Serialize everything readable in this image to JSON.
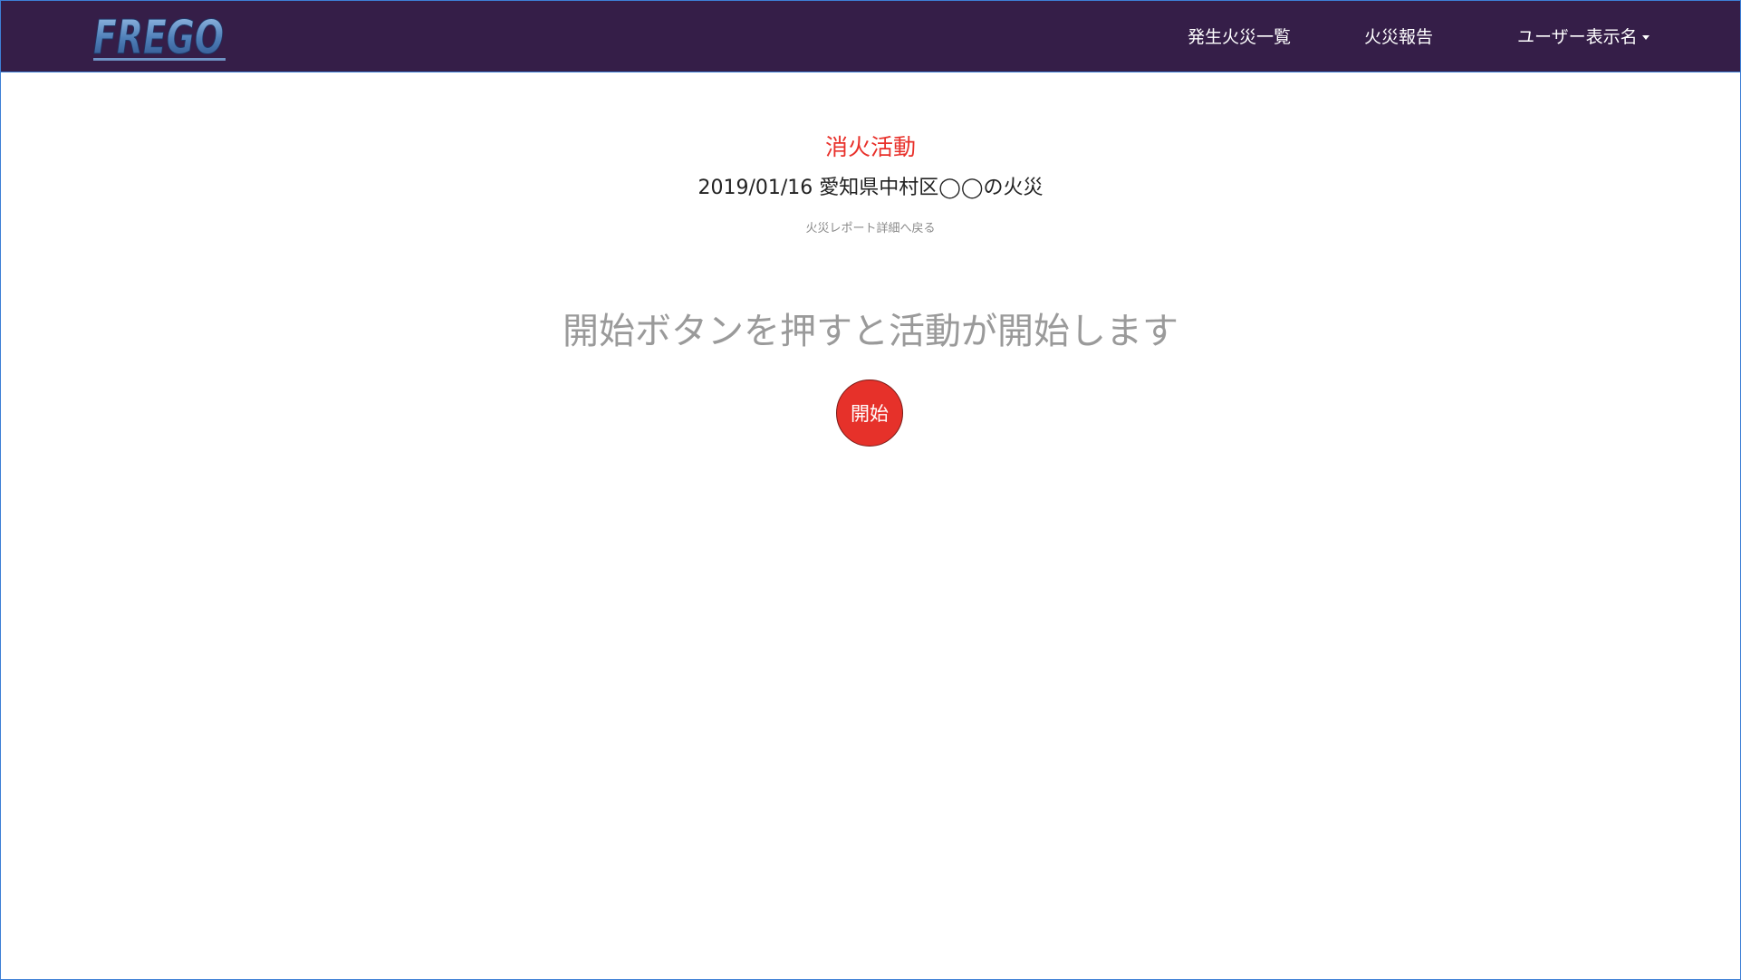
{
  "navbar": {
    "logo_text": "FREGO",
    "links": [
      {
        "label": "発生火災一覧"
      },
      {
        "label": "火災報告"
      }
    ],
    "user_menu_label": "ユーザー表示名"
  },
  "main": {
    "activity_title": "消火活動",
    "fire_name": "2019/01/16 愛知県中村区◯◯の火災",
    "back_link": "火災レポート詳細へ戻る",
    "instruction": "開始ボタンを押すと活動が開始します",
    "start_button": "開始"
  },
  "colors": {
    "navbar_bg": "#351e48",
    "accent_red": "#e6312a",
    "frame_border": "#3d7fd6",
    "muted_text": "#9a9a9a"
  }
}
